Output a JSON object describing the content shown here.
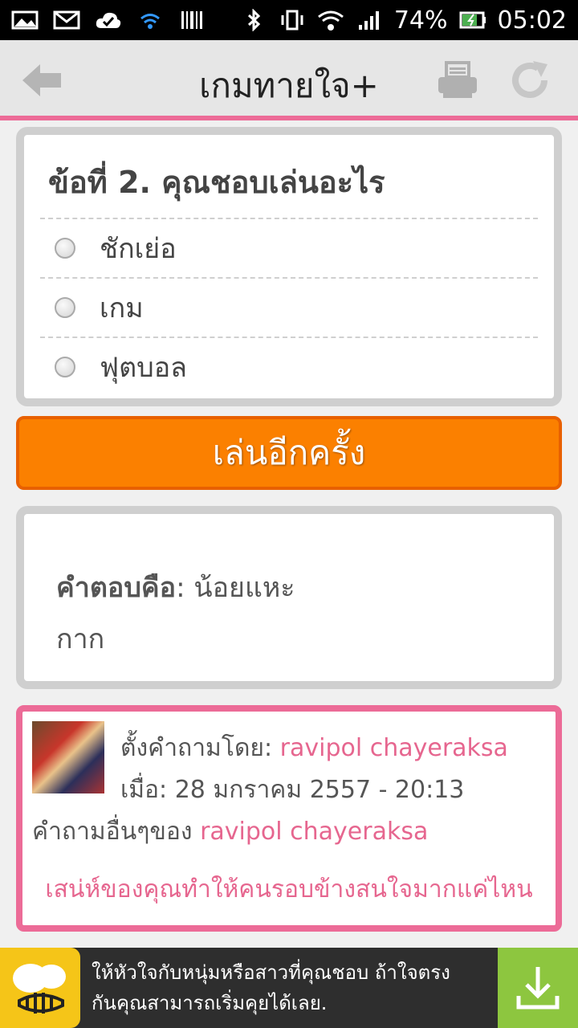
{
  "status_bar": {
    "battery": "74%",
    "time": "05:02",
    "icons": [
      "photo-icon",
      "gmail-icon",
      "cloud-check-icon",
      "wifi-small-icon",
      "barcode-icon",
      "bluetooth-icon",
      "vibrate-icon",
      "wifi-icon",
      "signal-icon",
      "battery-icon"
    ]
  },
  "header": {
    "title": "เกมทายใจ+",
    "back_icon": "back-arrow-icon",
    "print_icon": "printer-icon",
    "refresh_icon": "refresh-icon"
  },
  "question": {
    "title": "ข้อที่ 2. คุณชอบเล่นอะไร",
    "options": [
      "ชักเย่อ",
      "เกม",
      "ฟุตบอล"
    ]
  },
  "replay_button": "เล่นอีกครั้ง",
  "answer": {
    "label": "คำตอบคือ",
    "separator": ": ",
    "value_line1": "น้อยแหะ",
    "value_line2": "กาก"
  },
  "author": {
    "asked_by_label": "ตั้งคำถามโดย: ",
    "name": "ravipol chayeraksa",
    "date_label": "เมื่อ: ",
    "date": "28 มกราคม 2557 - 20:13",
    "other_label": "คำถามอื่นๆของ ",
    "other_name": "ravipol chayeraksa",
    "related_link": "เสน่ห์ของคุณทำให้คนรอบข้างสนใจมากแค่ไหน"
  },
  "ad": {
    "text_line1": "ให้หัวใจกับหนุ่มหรือสาวที่คุณชอบ ถ้าใจตรง",
    "text_line2": "กันคุณสามารถเริ่มคุยได้เลย."
  },
  "colors": {
    "accent_pink": "#ec6b97",
    "button_orange": "#fb8000",
    "ad_green": "#8dc63f"
  }
}
